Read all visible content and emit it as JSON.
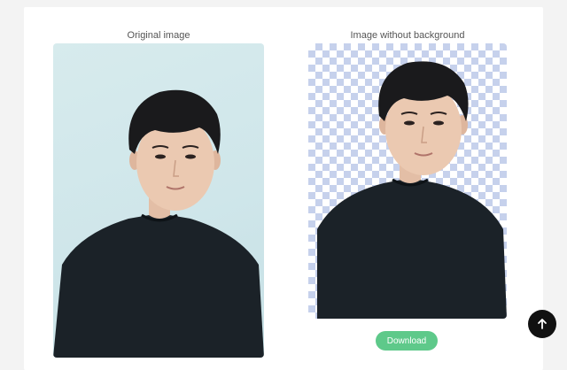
{
  "labels": {
    "original_caption": "Original image",
    "cutout_caption": "Image without background"
  },
  "actions": {
    "download_label": "Download",
    "scroll_top_icon": "arrow-up-icon"
  },
  "colors": {
    "accent": "#5ec98a",
    "scroll_button": "#111111",
    "checker": "#c6d1ec",
    "original_background": "#d7ebed"
  }
}
